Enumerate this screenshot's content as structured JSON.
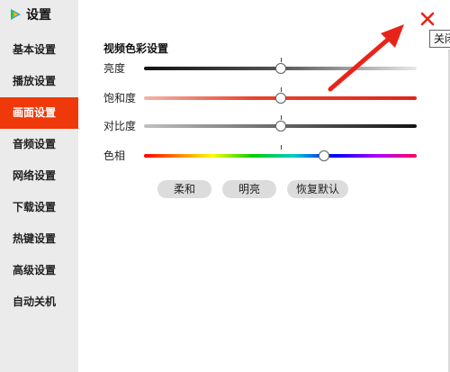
{
  "app": {
    "title": "设置"
  },
  "sidebar": {
    "items": [
      {
        "label": "基本设置",
        "active": false
      },
      {
        "label": "播放设置",
        "active": false
      },
      {
        "label": "画面设置",
        "active": true
      },
      {
        "label": "音频设置",
        "active": false
      },
      {
        "label": "网络设置",
        "active": false
      },
      {
        "label": "下载设置",
        "active": false
      },
      {
        "label": "热键设置",
        "active": false
      },
      {
        "label": "高级设置",
        "active": false
      },
      {
        "label": "自动关机",
        "active": false
      }
    ]
  },
  "main": {
    "section_title": "视频色彩设置",
    "sliders": [
      {
        "label": "亮度",
        "value_pct": 50
      },
      {
        "label": "饱和度",
        "value_pct": 50
      },
      {
        "label": "对比度",
        "value_pct": 50
      },
      {
        "label": "色相",
        "value_pct": 66
      }
    ],
    "presets": {
      "soft_label": "柔和",
      "bright_label": "明亮",
      "reset_label": "恢复默认"
    }
  },
  "window": {
    "close_glyph": "✕",
    "close_tooltip": "关闭"
  },
  "colors": {
    "accent": "#f0390a",
    "sidebar_bg": "#ebebeb",
    "pill_bg": "#dcdcdc",
    "annotation_arrow": "#e8241a"
  }
}
